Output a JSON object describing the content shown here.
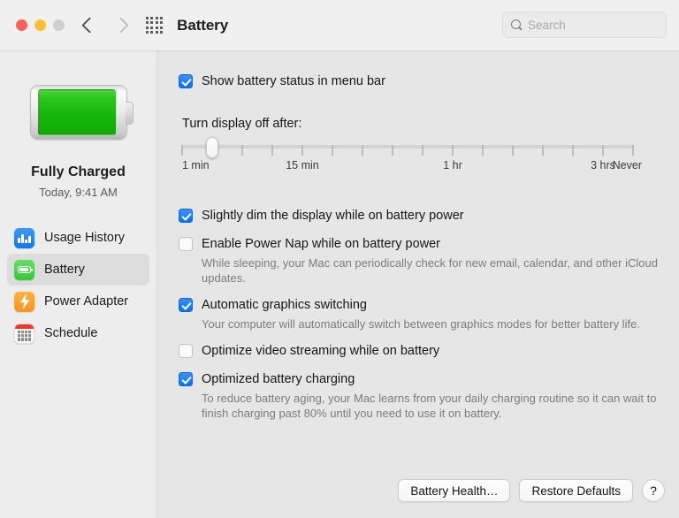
{
  "window": {
    "title": "Battery",
    "traffic_lights": [
      "close",
      "minimize",
      "zoom"
    ],
    "back_label": "Back",
    "forward_label": "Forward",
    "grid_label": "Show All"
  },
  "search": {
    "placeholder": "Search",
    "value": ""
  },
  "sidebar": {
    "battery_status": "Fully Charged",
    "battery_time": "Today, 9:41 AM",
    "items": [
      {
        "label": "Usage History",
        "icon": "chart-bar-icon",
        "selected": false
      },
      {
        "label": "Battery",
        "icon": "battery-icon",
        "selected": true
      },
      {
        "label": "Power Adapter",
        "icon": "bolt-icon",
        "selected": false
      },
      {
        "label": "Schedule",
        "icon": "calendar-icon",
        "selected": false
      }
    ]
  },
  "main": {
    "show_status_label": "Show battery status in menu bar",
    "show_status_checked": true,
    "display_off_label": "Turn display off after:",
    "slider": {
      "tick_count": 16,
      "thumb_index": 1,
      "tick_labels": [
        {
          "text": "1 min",
          "index": 0
        },
        {
          "text": "15 min",
          "index": 4
        },
        {
          "text": "1 hr",
          "index": 9
        },
        {
          "text": "3 hrs",
          "index": 14
        },
        {
          "text": "Never",
          "index": 15
        }
      ]
    },
    "options": [
      {
        "label": "Slightly dim the display while on battery power",
        "checked": true,
        "description": ""
      },
      {
        "label": "Enable Power Nap while on battery power",
        "checked": false,
        "description": "While sleeping, your Mac can periodically check for new email, calendar, and other iCloud updates."
      },
      {
        "label": "Automatic graphics switching",
        "checked": true,
        "description": "Your computer will automatically switch between graphics modes for better battery life."
      },
      {
        "label": "Optimize video streaming while on battery",
        "checked": false,
        "description": ""
      },
      {
        "label": "Optimized battery charging",
        "checked": true,
        "description": "To reduce battery aging, your Mac learns from your daily charging routine so it can wait to finish charging past 80% until you need to use it on battery."
      }
    ]
  },
  "footer": {
    "battery_health_label": "Battery Health…",
    "restore_defaults_label": "Restore Defaults",
    "help_label": "?"
  },
  "colors": {
    "accent_blue": "#0a72f0",
    "battery_green": "#2fc61e",
    "adapter_orange": "#f9941f",
    "calendar_red": "#f0372e",
    "sidebar_bg": "#ededed",
    "content_bg": "#e6e6e6",
    "titlebar_bg": "#f0f0f0"
  }
}
